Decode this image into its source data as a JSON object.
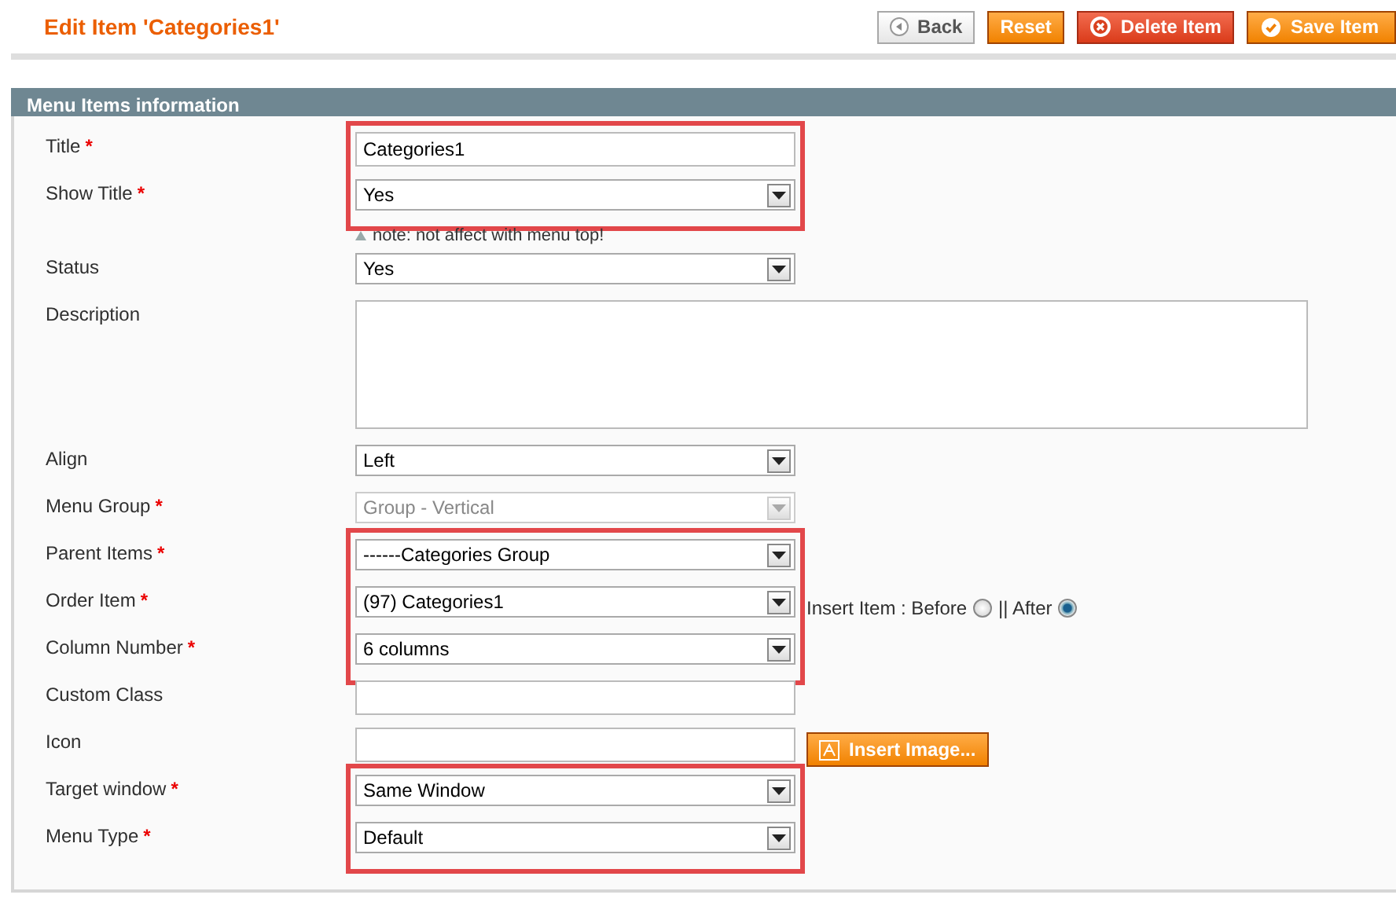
{
  "page_title": "Edit Item 'Categories1'",
  "buttons": [
    {
      "kind": "back",
      "label": "Back"
    },
    {
      "kind": "plain",
      "label": "Reset"
    },
    {
      "kind": "delete",
      "label": "Delete Item"
    },
    {
      "kind": "save",
      "label": "Save Item"
    }
  ],
  "section": {
    "title": "Menu Items information"
  },
  "groups": [
    {
      "highlighted": true,
      "fields": [
        {
          "label": "Title",
          "required_mark": "*",
          "kind": "text",
          "value": "Categories1"
        },
        {
          "label": "Show Title",
          "required_mark": "*",
          "kind": "select",
          "value": "Yes",
          "disabled": false
        }
      ]
    },
    {
      "highlighted": false,
      "fields": [
        {
          "kind": "note",
          "text": "note: not affect with menu top!"
        },
        {
          "label": "Status",
          "kind": "select",
          "value": "Yes",
          "disabled": false
        },
        {
          "label": "Description",
          "kind": "textarea"
        },
        {
          "label": "Align",
          "kind": "select",
          "value": "Left",
          "disabled": false
        },
        {
          "label": "Menu Group",
          "required_mark": "*",
          "kind": "select",
          "value": "Group - Vertical",
          "disabled": true
        }
      ]
    },
    {
      "highlighted": true,
      "fields": [
        {
          "label": "Parent Items",
          "required_mark": "*",
          "kind": "select",
          "value": "------Categories Group",
          "disabled": false
        },
        {
          "label": "Order Item",
          "required_mark": "*",
          "kind": "select",
          "value": "(97) Categories1",
          "disabled": false,
          "extras": [
            {
              "kind": "text",
              "text": "Insert Item : Before"
            },
            {
              "kind": "radio",
              "checked": false
            },
            {
              "kind": "text",
              "text": "|| After"
            },
            {
              "kind": "radio",
              "checked": true
            }
          ]
        },
        {
          "label": "Column Number",
          "required_mark": "*",
          "kind": "select",
          "value": "6 columns",
          "disabled": false
        }
      ]
    },
    {
      "highlighted": false,
      "fields": [
        {
          "label": "Custom Class",
          "kind": "text"
        },
        {
          "label": "Icon",
          "kind": "text",
          "extras": [
            {
              "kind": "button",
              "text": "Insert Image..."
            }
          ]
        }
      ]
    },
    {
      "highlighted": true,
      "fields": [
        {
          "label": "Target window",
          "required_mark": "*",
          "kind": "select",
          "value": "Same Window",
          "disabled": false
        },
        {
          "label": "Menu Type",
          "required_mark": "*",
          "kind": "select",
          "value": "Default",
          "disabled": false
        }
      ]
    }
  ]
}
